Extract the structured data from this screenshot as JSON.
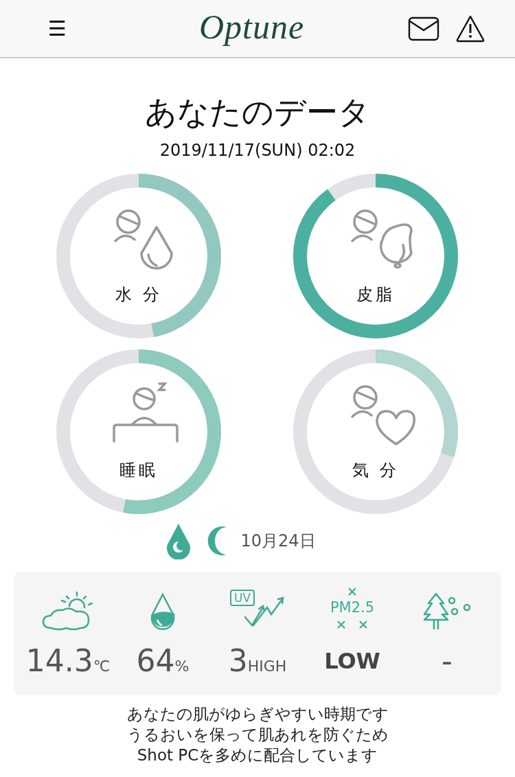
{
  "header": {
    "menu": "☰",
    "logo": "Optune"
  },
  "title": "あなたのデータ",
  "datetime": "2019/11/17(SUN) 02:02",
  "gauges": [
    {
      "kind": "moisture",
      "label": "水 分",
      "level": 0.47,
      "color": "#92c8bf"
    },
    {
      "kind": "sebum",
      "label": "皮脂",
      "level": 0.9,
      "color": "#4bb09f"
    },
    {
      "kind": "sleep",
      "label": "睡眠",
      "level": 0.53,
      "color": "#8ccbbd"
    },
    {
      "kind": "mood",
      "label": "気 分",
      "level": 0.3,
      "color": "#b2d6d0"
    }
  ],
  "shot_date": "10月24日",
  "weather": [
    {
      "kind": "temperature",
      "value": "14.3",
      "unit": "℃"
    },
    {
      "kind": "humidity",
      "value": "64",
      "unit": "%"
    },
    {
      "kind": "uv",
      "icon_text": "UV",
      "value": "3",
      "unit": "HIGH"
    },
    {
      "kind": "pm25",
      "icon_text": "PM2.5",
      "value": "LOW"
    },
    {
      "kind": "pollen",
      "value": "-"
    }
  ],
  "message": [
    "あなたの肌がゆらぎやすい時期です",
    "うるおいを保って肌あれを防ぐため",
    "Shot PCを多めに配合しています"
  ]
}
